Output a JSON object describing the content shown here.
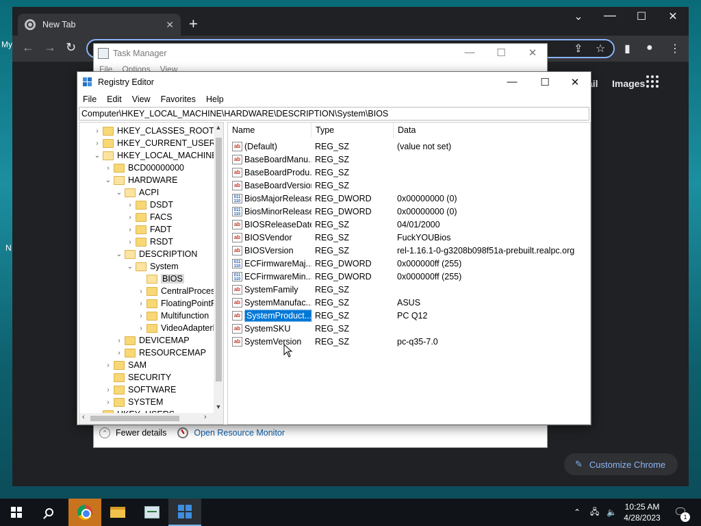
{
  "desktop": {
    "left_text_1": "My",
    "left_text_2": "N"
  },
  "chrome": {
    "tab_title": "New Tab",
    "tab_close": "✕",
    "new_tab": "+",
    "min": "⌄",
    "restore": "☐",
    "close": "✕",
    "links": {
      "gmail_partial": "ail",
      "images": "Images"
    },
    "customize_label": "Customize Chrome"
  },
  "taskmgr": {
    "title": "Task Manager",
    "menu": [
      "File",
      "Options",
      "View"
    ],
    "fewer_details": "Fewer details",
    "open_resource_monitor": "Open Resource Monitor"
  },
  "regedit": {
    "title": "Registry Editor",
    "menu": [
      "File",
      "Edit",
      "View",
      "Favorites",
      "Help"
    ],
    "address": "Computer\\HKEY_LOCAL_MACHINE\\HARDWARE\\DESCRIPTION\\System\\BIOS",
    "tree": [
      {
        "label": "HKEY_CLASSES_ROOT",
        "depth": 0,
        "arrow": "›"
      },
      {
        "label": "HKEY_CURRENT_USER",
        "depth": 0,
        "arrow": "›"
      },
      {
        "label": "HKEY_LOCAL_MACHINE",
        "depth": 0,
        "arrow": "⌄"
      },
      {
        "label": "BCD00000000",
        "depth": 1,
        "arrow": "›"
      },
      {
        "label": "HARDWARE",
        "depth": 1,
        "arrow": "⌄"
      },
      {
        "label": "ACPI",
        "depth": 2,
        "arrow": "⌄"
      },
      {
        "label": "DSDT",
        "depth": 3,
        "arrow": "›"
      },
      {
        "label": "FACS",
        "depth": 3,
        "arrow": "›"
      },
      {
        "label": "FADT",
        "depth": 3,
        "arrow": "›"
      },
      {
        "label": "RSDT",
        "depth": 3,
        "arrow": "›"
      },
      {
        "label": "DESCRIPTION",
        "depth": 2,
        "arrow": "⌄"
      },
      {
        "label": "System",
        "depth": 3,
        "arrow": "⌄"
      },
      {
        "label": "BIOS",
        "depth": 4,
        "arrow": "",
        "selected": true
      },
      {
        "label": "CentralProcess",
        "depth": 4,
        "arrow": "›"
      },
      {
        "label": "FloatingPointP",
        "depth": 4,
        "arrow": "›"
      },
      {
        "label": "Multifunction",
        "depth": 4,
        "arrow": "›"
      },
      {
        "label": "VideoAdapterB",
        "depth": 4,
        "arrow": "›"
      },
      {
        "label": "DEVICEMAP",
        "depth": 2,
        "arrow": "›"
      },
      {
        "label": "RESOURCEMAP",
        "depth": 2,
        "arrow": "›"
      },
      {
        "label": "SAM",
        "depth": 1,
        "arrow": "›"
      },
      {
        "label": "SECURITY",
        "depth": 1,
        "arrow": ""
      },
      {
        "label": "SOFTWARE",
        "depth": 1,
        "arrow": "›"
      },
      {
        "label": "SYSTEM",
        "depth": 1,
        "arrow": "›"
      },
      {
        "label": "HKEY_USERS",
        "depth": 0,
        "arrow": "›"
      }
    ],
    "columns": {
      "name": "Name",
      "type": "Type",
      "data": "Data"
    },
    "values": [
      {
        "name": "(Default)",
        "type": "REG_SZ",
        "data": "(value not set)",
        "icon": "ab"
      },
      {
        "name": "BaseBoardManu...",
        "type": "REG_SZ",
        "data": "",
        "icon": "ab"
      },
      {
        "name": "BaseBoardProdu...",
        "type": "REG_SZ",
        "data": "",
        "icon": "ab"
      },
      {
        "name": "BaseBoardVersion",
        "type": "REG_SZ",
        "data": "",
        "icon": "ab"
      },
      {
        "name": "BiosMajorRelease",
        "type": "REG_DWORD",
        "data": "0x00000000 (0)",
        "icon": "bin"
      },
      {
        "name": "BiosMinorRelease",
        "type": "REG_DWORD",
        "data": "0x00000000 (0)",
        "icon": "bin"
      },
      {
        "name": "BIOSReleaseDate",
        "type": "REG_SZ",
        "data": "04/01/2000",
        "icon": "ab"
      },
      {
        "name": "BIOSVendor",
        "type": "REG_SZ",
        "data": "FuckYOUBios",
        "icon": "ab"
      },
      {
        "name": "BIOSVersion",
        "type": "REG_SZ",
        "data": "rel-1.16.1-0-g3208b098f51a-prebuilt.realpc.org",
        "icon": "ab"
      },
      {
        "name": "ECFirmwareMaj...",
        "type": "REG_DWORD",
        "data": "0x000000ff (255)",
        "icon": "bin"
      },
      {
        "name": "ECFirmwareMin...",
        "type": "REG_DWORD",
        "data": "0x000000ff (255)",
        "icon": "bin"
      },
      {
        "name": "SystemFamily",
        "type": "REG_SZ",
        "data": "",
        "icon": "ab"
      },
      {
        "name": "SystemManufac...",
        "type": "REG_SZ",
        "data": "ASUS",
        "icon": "ab"
      },
      {
        "name": "SystemProduct...",
        "type": "REG_SZ",
        "data": "PC Q12",
        "icon": "ab",
        "selected": true
      },
      {
        "name": "SystemSKU",
        "type": "REG_SZ",
        "data": "",
        "icon": "ab"
      },
      {
        "name": "SystemVersion",
        "type": "REG_SZ",
        "data": "pc-q35-7.0",
        "icon": "ab"
      }
    ]
  },
  "taskbar": {
    "time": "10:25 AM",
    "date": "4/28/2023",
    "notification_count": "1",
    "icons": [
      "windows-start",
      "search",
      "chrome",
      "file-explorer",
      "task-manager",
      "registry-editor"
    ]
  },
  "colors": {
    "selection": "#0078d7",
    "chrome_bg": "#202124",
    "chrome_accent": "#8ab4f8",
    "folder": "#f8d775"
  }
}
